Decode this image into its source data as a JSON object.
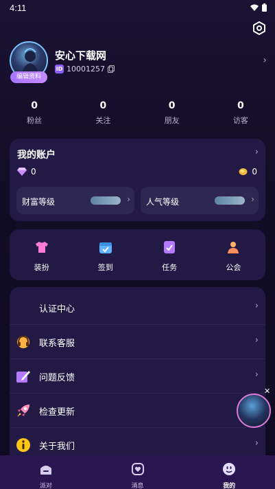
{
  "status_bar": {
    "time": "4:11"
  },
  "profile": {
    "username": "安心下载网",
    "user_id": "10001257",
    "id_badge": "ID",
    "edit_label": "编辑资料"
  },
  "stats": [
    {
      "value": "0",
      "label": "粉丝"
    },
    {
      "value": "0",
      "label": "关注"
    },
    {
      "value": "0",
      "label": "朋友"
    },
    {
      "value": "0",
      "label": "访客"
    }
  ],
  "account": {
    "title": "我的账户",
    "diamond_count": "0",
    "coin_count": "0",
    "wealth_level_label": "财富等级",
    "popularity_level_label": "人气等级"
  },
  "quick_actions": [
    {
      "label": "装扮",
      "icon": "shirt-icon"
    },
    {
      "label": "签到",
      "icon": "calendar-icon"
    },
    {
      "label": "任务",
      "icon": "task-icon"
    },
    {
      "label": "公会",
      "icon": "guild-icon"
    }
  ],
  "menu": [
    {
      "label": "认证中心",
      "icon": "none"
    },
    {
      "label": "联系客服",
      "icon": "headset-icon"
    },
    {
      "label": "问题反馈",
      "icon": "feedback-icon"
    },
    {
      "label": "检查更新",
      "icon": "rocket-icon"
    },
    {
      "label": "关于我们",
      "icon": "info-icon"
    }
  ],
  "tabs": [
    {
      "label": "派对",
      "icon": "party-icon"
    },
    {
      "label": "消息",
      "icon": "message-icon"
    },
    {
      "label": "我的",
      "icon": "me-icon",
      "active": true
    }
  ],
  "colors": {
    "accent": "#a874ff",
    "tab_bar": "#2a1650",
    "card": "#221a45"
  }
}
